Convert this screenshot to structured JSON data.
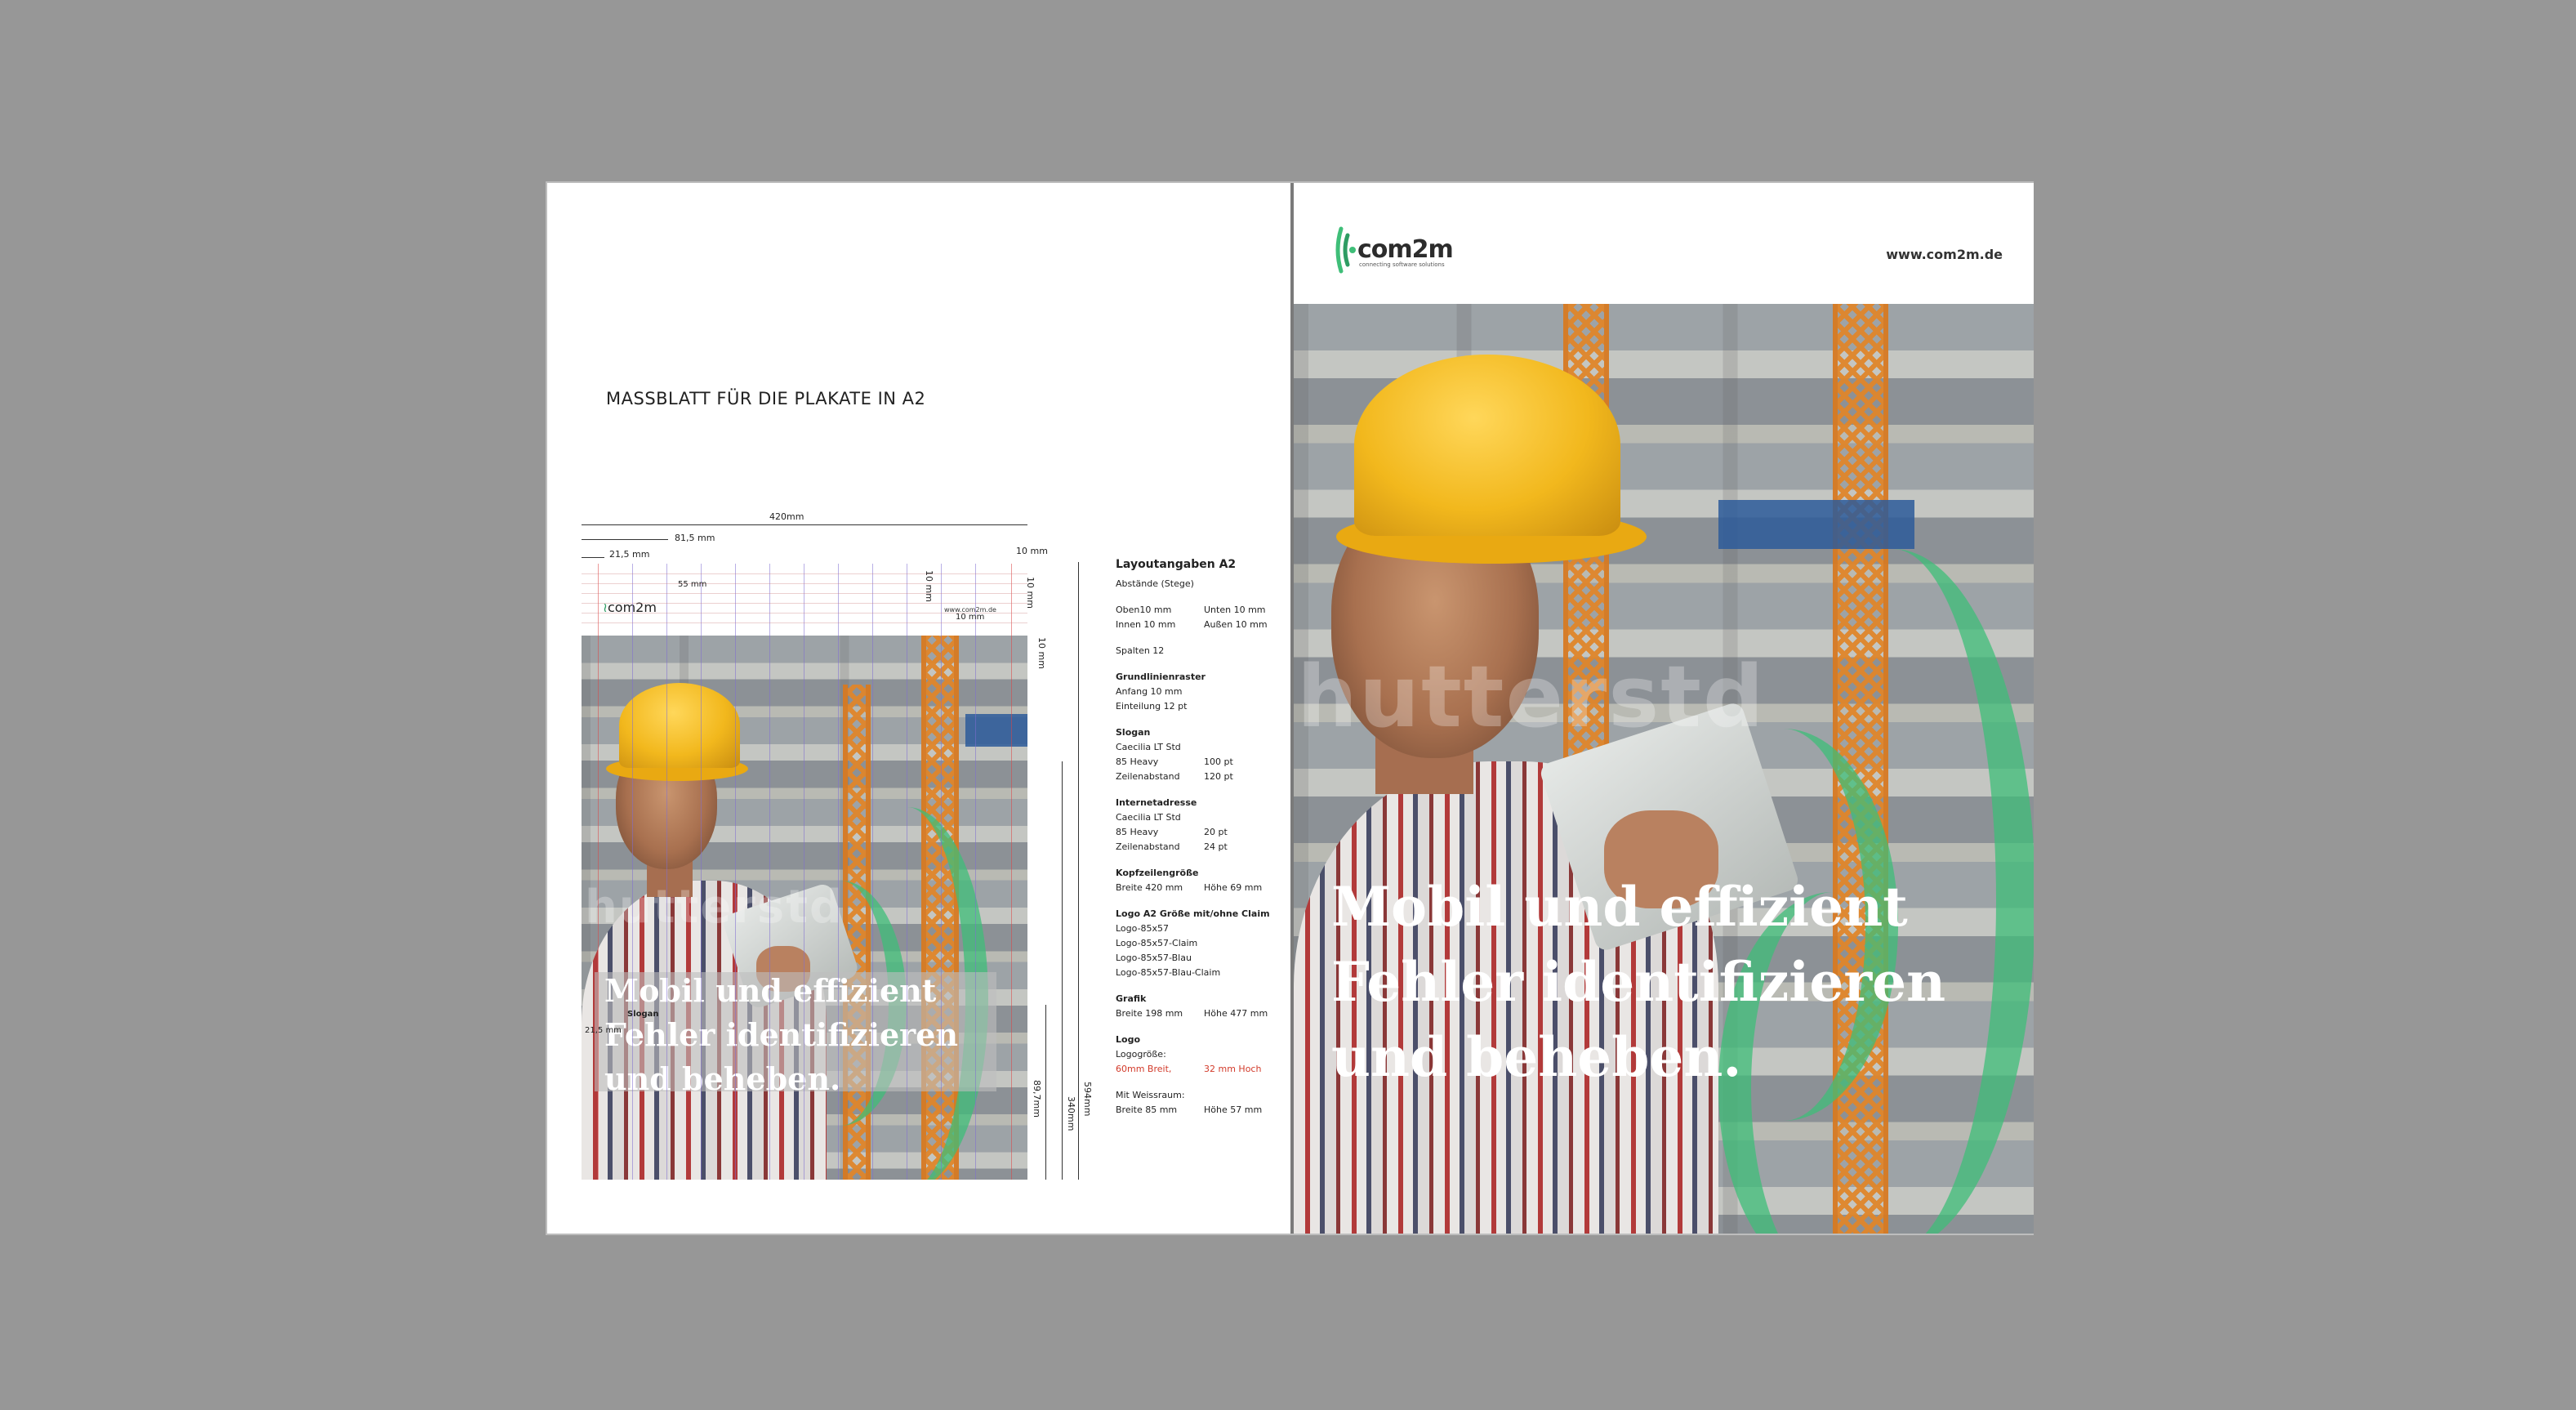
{
  "sheet": {
    "title": "MASSBLATT FÜR DIE PLAKATE IN A2"
  },
  "dimensions": {
    "width_total": "420mm",
    "width_815": "81,5 mm",
    "width_215": "21,5 mm",
    "width_55": "55 mm",
    "margin_10_top": "10 mm",
    "margin_10_a": "10 mm",
    "margin_10_b": "10 mm",
    "margin_10_c": "10 mm",
    "margin_10_d": "10 mm",
    "height_total": "594mm",
    "height_340": "340mm",
    "height_897": "89,7mm",
    "left_215": "21,5 mm",
    "slogan_label": "Slogan"
  },
  "thumbnail": {
    "logo_text": "com2m",
    "url": "www.com2m.de",
    "watermark": "hutterstd",
    "slogan_lines": [
      "Mobil und effizient",
      "Fehler identifizieren",
      "und beheben."
    ]
  },
  "specs": {
    "heading": "Layoutangaben A2",
    "abstaende": "Abstände (Stege)",
    "oben": "Oben10 mm",
    "unten": "Unten 10 mm",
    "innen": "Innen 10 mm",
    "aussen": "Außen 10 mm",
    "spalten": "Spalten 12",
    "raster_title": "Grundlinienraster",
    "raster_anfang": "Anfang    10 mm",
    "raster_einteilung": "Einteilung   12 pt",
    "slogan_title": "Slogan",
    "slogan_font": "Caecilia LT Std",
    "slogan_weight": "85 Heavy",
    "slogan_size": "100 pt",
    "slogan_lh_label": "Zeilenabstand",
    "slogan_lh": "120 pt",
    "url_title": "Internetadresse",
    "url_font": "Caecilia LT Std",
    "url_weight": "85 Heavy",
    "url_size": "20 pt",
    "url_lh_label": "Zeilenabstand",
    "url_lh": "24 pt",
    "head_title": "Kopfzeilengröße",
    "head_w": "Breite 420 mm",
    "head_h": "Höhe 69 mm",
    "logo_title": "Logo A2 Größe mit/ohne Claim",
    "logo_items": [
      "Logo-85x57",
      "Logo-85x57-Claim",
      "Logo-85x57-Blau",
      "Logo-85x57-Blau-Claim"
    ],
    "grafik_title": "Grafik",
    "grafik_w": "Breite 198 mm",
    "grafik_h": "Höhe 477 mm",
    "logo2_title": "Logo",
    "logo2_size_label": "Logogröße:",
    "logo2_w": "60mm Breit,",
    "logo2_h": "32 mm Hoch",
    "weiss_label": "Mit Weissraum:",
    "weiss_w": "Breite 85 mm",
    "weiss_h": "Höhe 57 mm"
  },
  "poster": {
    "logo_text": "com2m",
    "claim": "connecting software solutions",
    "url": "www.com2m.de",
    "watermark": "hutterstd",
    "slogan_lines": [
      "Mobil und effizient",
      "Fehler identifizieren",
      "und beheben."
    ]
  },
  "colors": {
    "brand_green": "#3fbe78",
    "red_note": "#d23a2a",
    "background": "#979797"
  }
}
